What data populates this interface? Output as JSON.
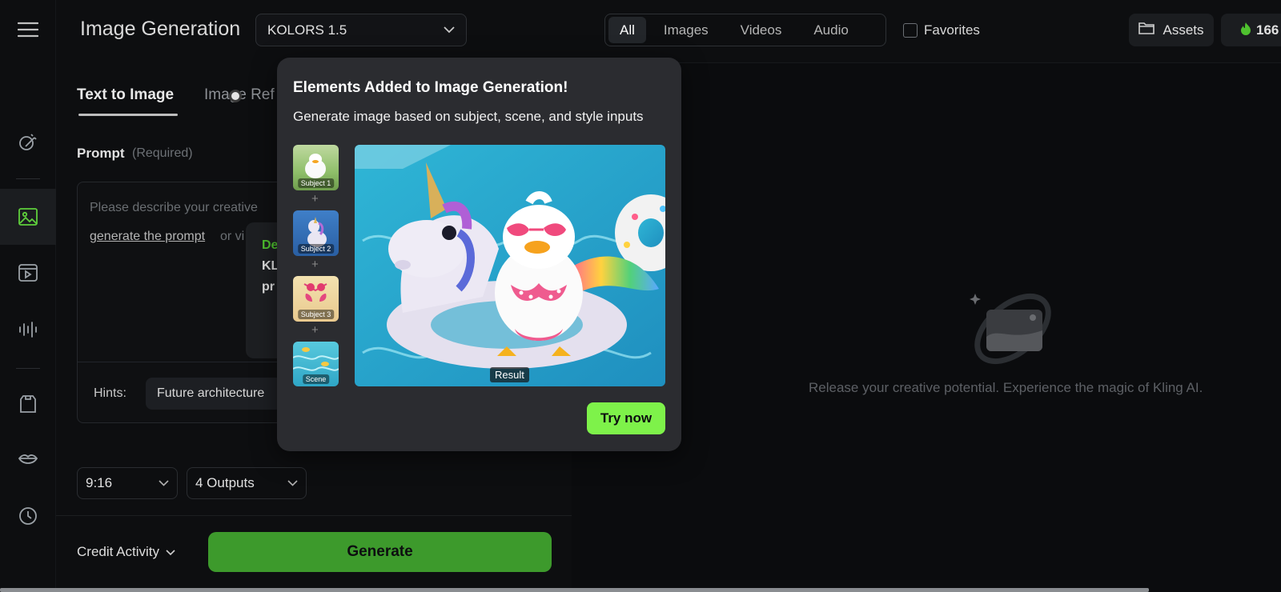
{
  "header": {
    "title": "Image Generation",
    "model": "KOLORS 1.5",
    "filters": [
      "All",
      "Images",
      "Videos",
      "Audio"
    ],
    "filter_selected": "All",
    "favorites_label": "Favorites",
    "assets_label": "Assets",
    "credits": "166"
  },
  "tabs": {
    "text_to_image": "Text to Image",
    "image_ref": "Image Ref"
  },
  "prompt": {
    "label": "Prompt",
    "required": "(Required)",
    "placeholder_start": "Please describe your creative",
    "generate_link": "generate the prompt",
    "or_text": "or vi"
  },
  "tip": {
    "line1": "De",
    "line2": "KL",
    "line3": "pr"
  },
  "hints": {
    "label": "Hints:",
    "chip": "Future architecture"
  },
  "settings": {
    "ratio": "9:16",
    "outputs": "4 Outputs"
  },
  "footer": {
    "credit_activity": "Credit Activity",
    "generate": "Generate"
  },
  "empty_state": {
    "text": "Release your creative potential. Experience the magic of Kling AI."
  },
  "popup": {
    "title": "Elements Added to Image Generation!",
    "subtitle": "Generate image based on subject, scene, and style inputs",
    "thumbs": [
      "Subject 1",
      "Subject 2",
      "Subject 3",
      "Scene"
    ],
    "result_label": "Result",
    "try_button": "Try now"
  },
  "colors": {
    "accent_green": "#3d9a2c",
    "try_green": "#7ef24a"
  }
}
